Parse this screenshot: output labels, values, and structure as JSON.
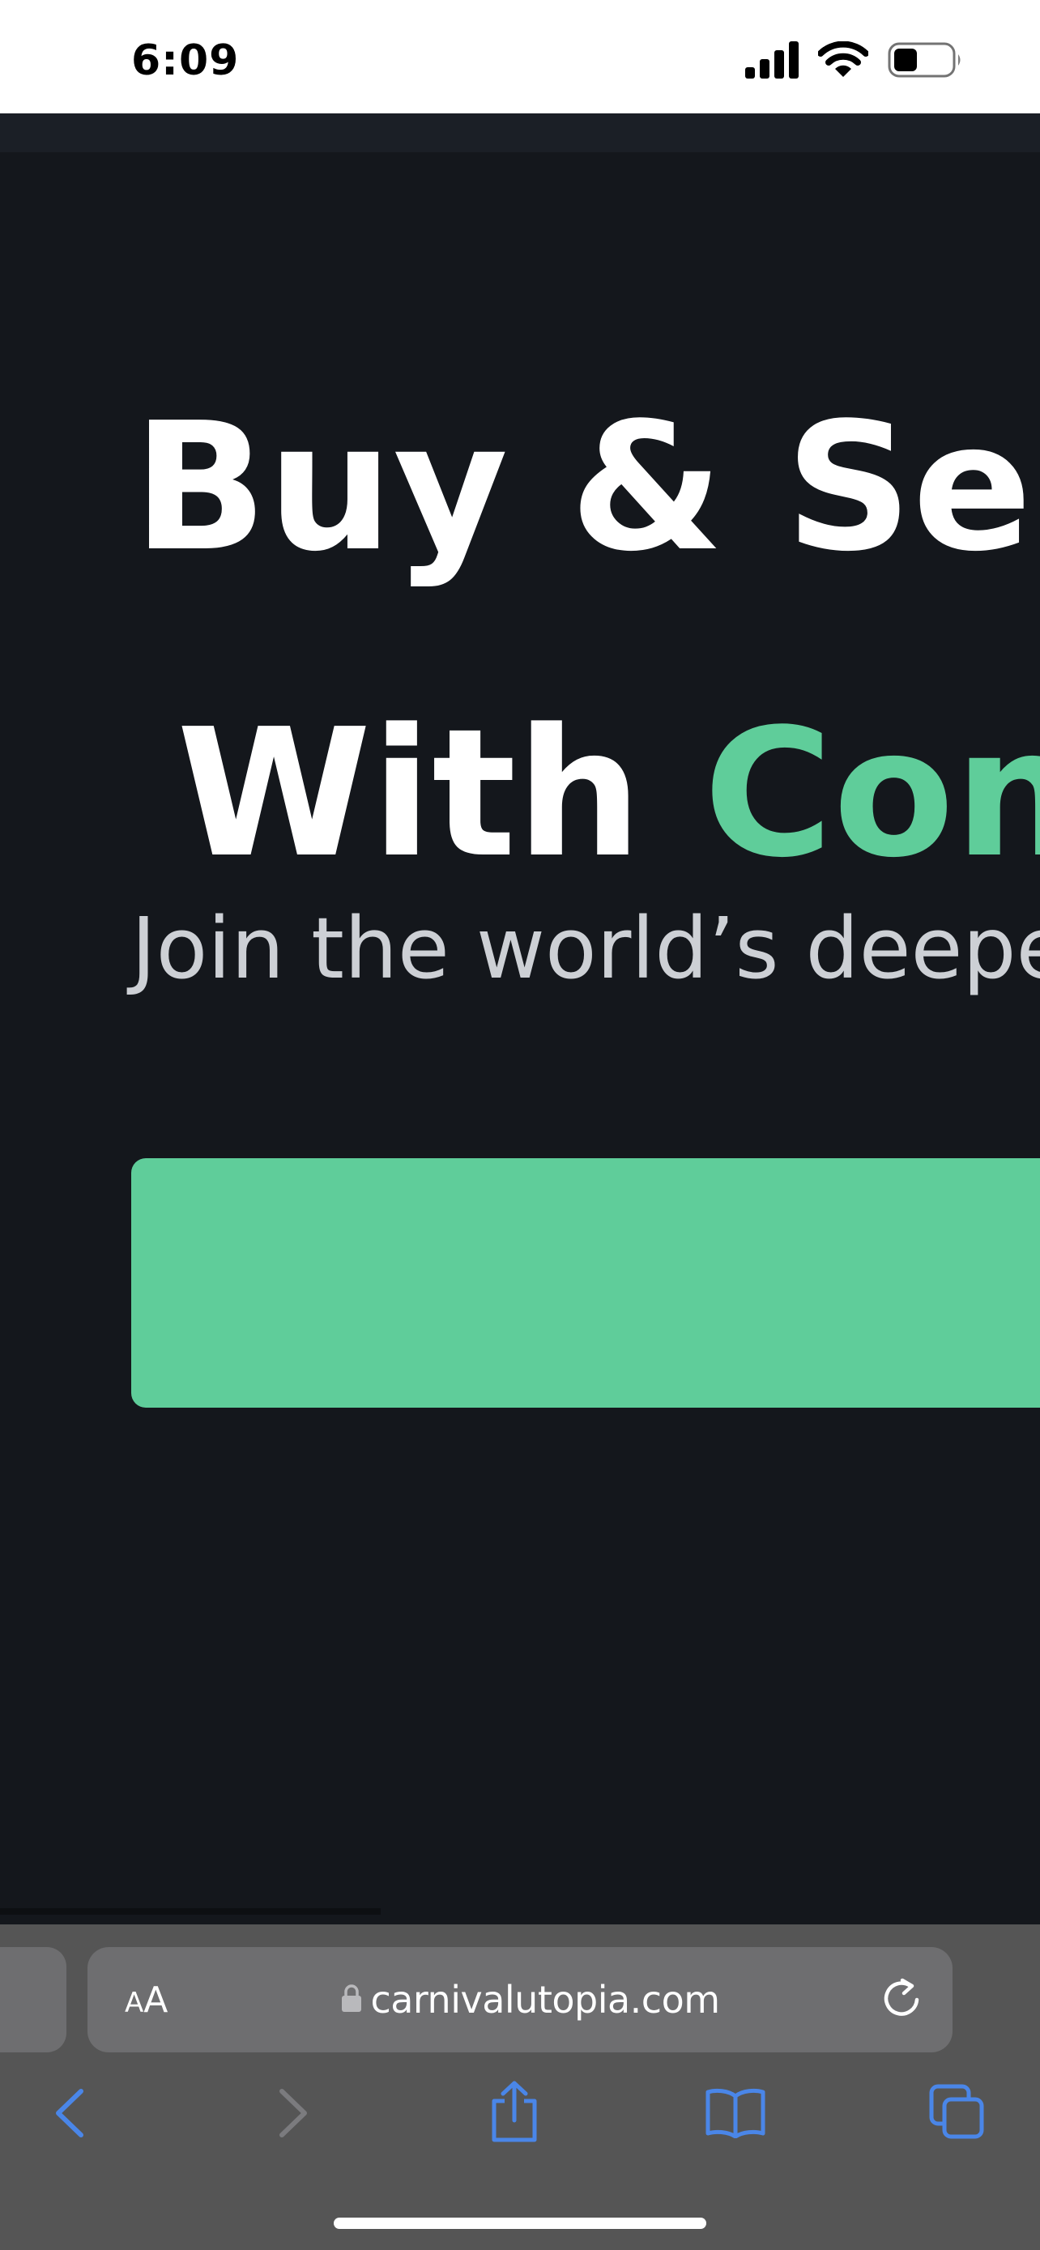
{
  "status_bar": {
    "time": "6:09",
    "icons": [
      "signal-icon",
      "wifi-icon",
      "battery-icon"
    ]
  },
  "hero": {
    "line1": "Buy & Sell",
    "line2_prefix": "With",
    "line2_accent": "Confi",
    "subtitle": "Join the world’s deepe",
    "accent_color": "#5fcd9a",
    "cta_label": ""
  },
  "safari": {
    "text_size_small": "A",
    "text_size_big": "A",
    "url": "carnivalutopia.com",
    "toolbar_icons": [
      "back-icon",
      "forward-icon",
      "share-icon",
      "bookmarks-icon",
      "tabs-icon"
    ],
    "tint_color": "#4a86e8"
  },
  "colors": {
    "page_background": "#14171c",
    "hero_text": "#ffffff",
    "subtitle_text": "#cdd0d5"
  }
}
